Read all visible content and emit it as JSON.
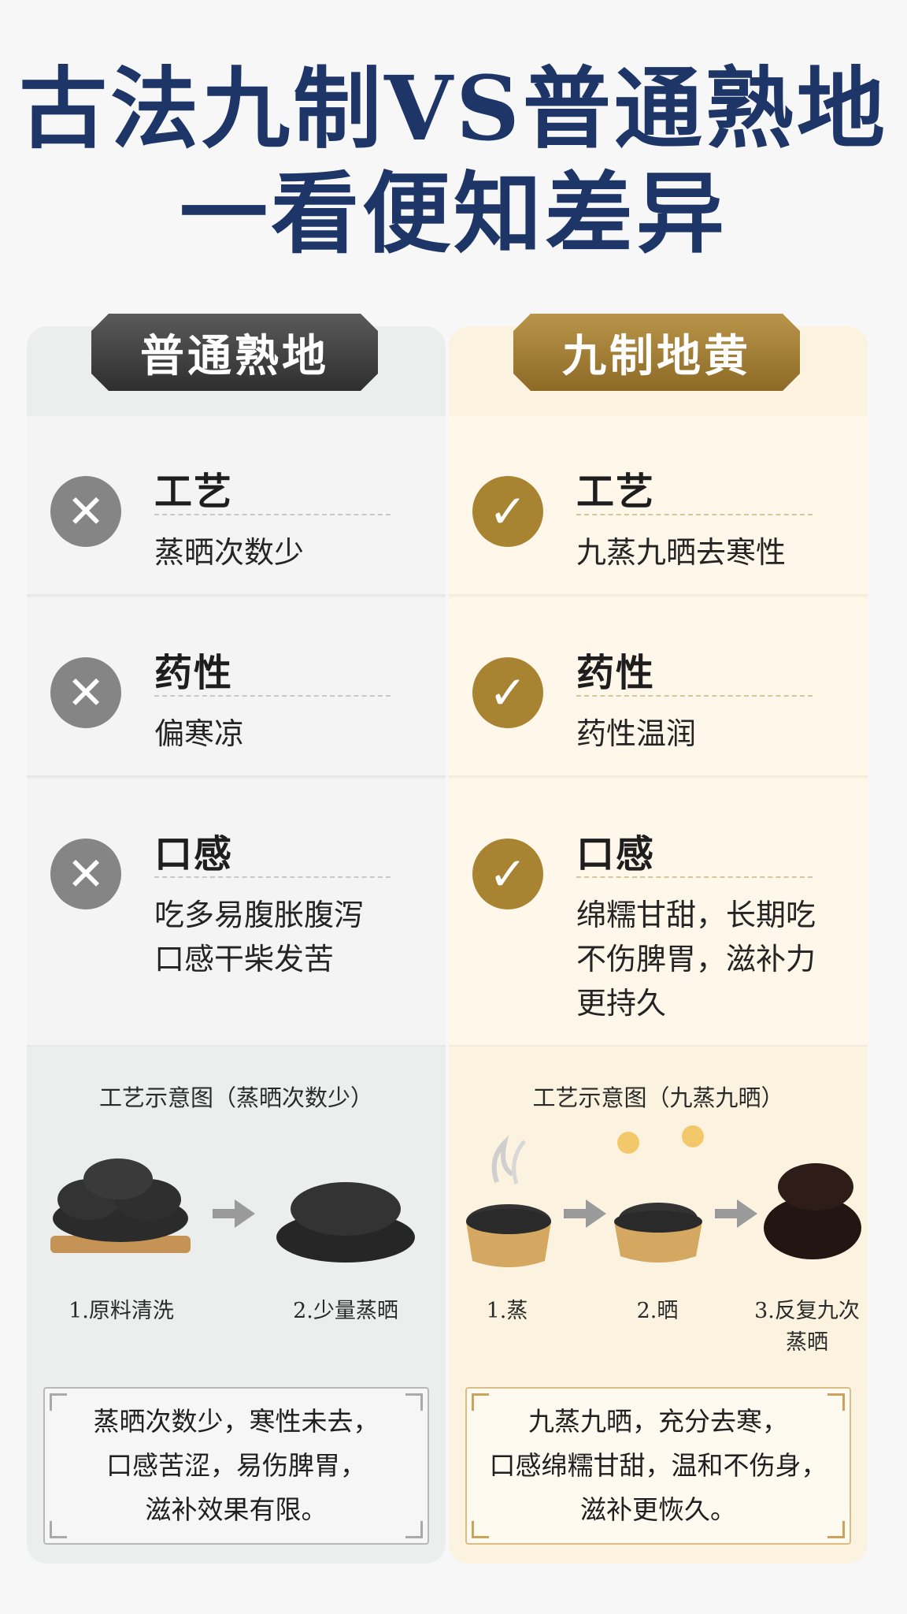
{
  "title": {
    "line1": "古法九制VS普通熟地",
    "line2": "一看便知差异"
  },
  "left": {
    "header": "普通熟地",
    "items": [
      {
        "title": "工艺",
        "text": "蒸晒次数少",
        "icon": "cross-icon"
      },
      {
        "title": "药性",
        "text": "偏寒凉",
        "icon": "cross-icon"
      },
      {
        "title": "口感",
        "text": "吃多易腹胀腹泻\n口感干柴发苦",
        "icon": "cross-icon"
      }
    ],
    "diagram": {
      "title": "工艺示意图（蒸晒次数少）",
      "steps": [
        "1.原料清洗",
        "2.少量蒸晒"
      ]
    },
    "note": "蒸晒次数少，寒性未去，\n口感苦涩，易伤脾胃，\n滋补效果有限。"
  },
  "right": {
    "header": "九制地黄",
    "items": [
      {
        "title": "工艺",
        "text": "九蒸九晒去寒性",
        "icon": "check-icon"
      },
      {
        "title": "药性",
        "text": "药性温润",
        "icon": "check-icon"
      },
      {
        "title": "口感",
        "text": "绵糯甘甜，长期吃\n不伤脾胃，滋补力\n更持久",
        "icon": "check-icon"
      }
    ],
    "diagram": {
      "title": "工艺示意图（九蒸九晒）",
      "steps": [
        "1.蒸",
        "2.晒",
        "3.反复九次\n蒸晒"
      ]
    },
    "note": "九蒸九晒，充分去寒，\n口感绵糯甘甜，温和不伤身，\n滋补更恢久。"
  },
  "colors": {
    "title": "#1d3567",
    "gold": "#a88432",
    "gray": "#858585"
  }
}
